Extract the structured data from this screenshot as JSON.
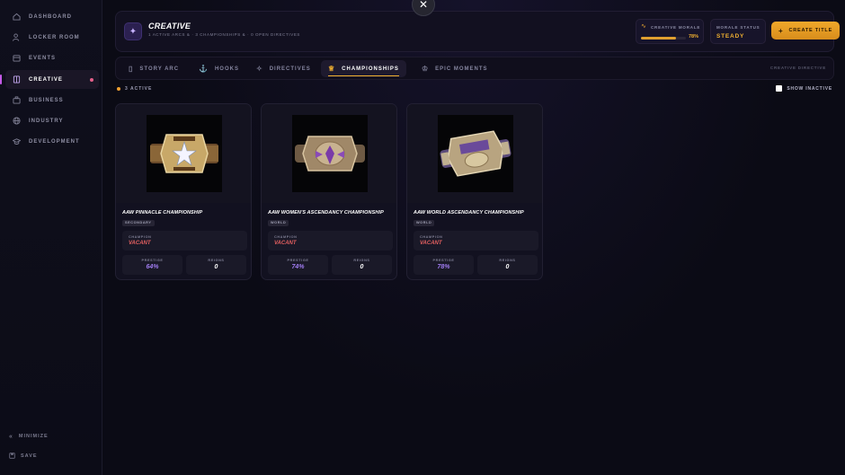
{
  "sidebar": {
    "items": [
      {
        "label": "DASHBOARD",
        "icon": "home-icon"
      },
      {
        "label": "LOCKER ROOM",
        "icon": "users-icon"
      },
      {
        "label": "EVENTS",
        "icon": "calendar-icon"
      },
      {
        "label": "CREATIVE",
        "icon": "book-icon",
        "active": true
      },
      {
        "label": "BUSINESS",
        "icon": "briefcase-icon"
      },
      {
        "label": "INDUSTRY",
        "icon": "globe-icon"
      },
      {
        "label": "DEVELOPMENT",
        "icon": "graduation-icon"
      }
    ],
    "minimize_label": "MINIMIZE",
    "save_label": "SAVE"
  },
  "header": {
    "title": "CREATIVE",
    "subtitle": "1 ACTIVE ARCS & · 3 CHAMPIONSHIPS & · 0 OPEN DIRECTIVES",
    "morale": {
      "label": "CREATIVE MORALE",
      "value_text": "78%",
      "value": 0.78
    },
    "status": {
      "label": "MORALE STATUS",
      "value": "STEADY"
    },
    "create_label": "CREATE TITLE"
  },
  "tabs": [
    {
      "label": "STORY ARC",
      "icon": "book-icon"
    },
    {
      "label": "HOOKS",
      "icon": "anchor-icon"
    },
    {
      "label": "DIRECTIVES",
      "icon": "sparkle-icon"
    },
    {
      "label": "CHAMPIONSHIPS",
      "icon": "trophy-icon",
      "active": true
    },
    {
      "label": "EPIC MOMENTS",
      "icon": "trophy-outline-icon"
    }
  ],
  "tab_right_label": "CREATIVE DIRECTIVE",
  "active_label": "3 ACTIVE",
  "show_inactive_label": "SHOW INACTIVE",
  "cards": [
    {
      "name": "AAW PINNACLE CHAMPIONSHIP",
      "tier": "SECONDARY",
      "champion_label": "CHAMPION",
      "champion": "VACANT",
      "prestige_label": "PRESTIGE",
      "prestige": "64%",
      "reigns_label": "REIGNS",
      "reigns": "0"
    },
    {
      "name": "AAW WOMEN'S ASCENDANCY CHAMPIONSHIP",
      "tier": "WORLD",
      "champion_label": "CHAMPION",
      "champion": "VACANT",
      "prestige_label": "PRESTIGE",
      "prestige": "74%",
      "reigns_label": "REIGNS",
      "reigns": "0"
    },
    {
      "name": "AAW WORLD ASCENDANCY CHAMPIONSHIP",
      "tier": "WORLD",
      "champion_label": "CHAMPION",
      "champion": "VACANT",
      "prestige_label": "PRESTIGE",
      "prestige": "78%",
      "reigns_label": "REIGNS",
      "reigns": "0"
    }
  ],
  "colors": {
    "accent": "#f0b030",
    "vacant": "#e46060",
    "prestige": "#a07cf0"
  }
}
